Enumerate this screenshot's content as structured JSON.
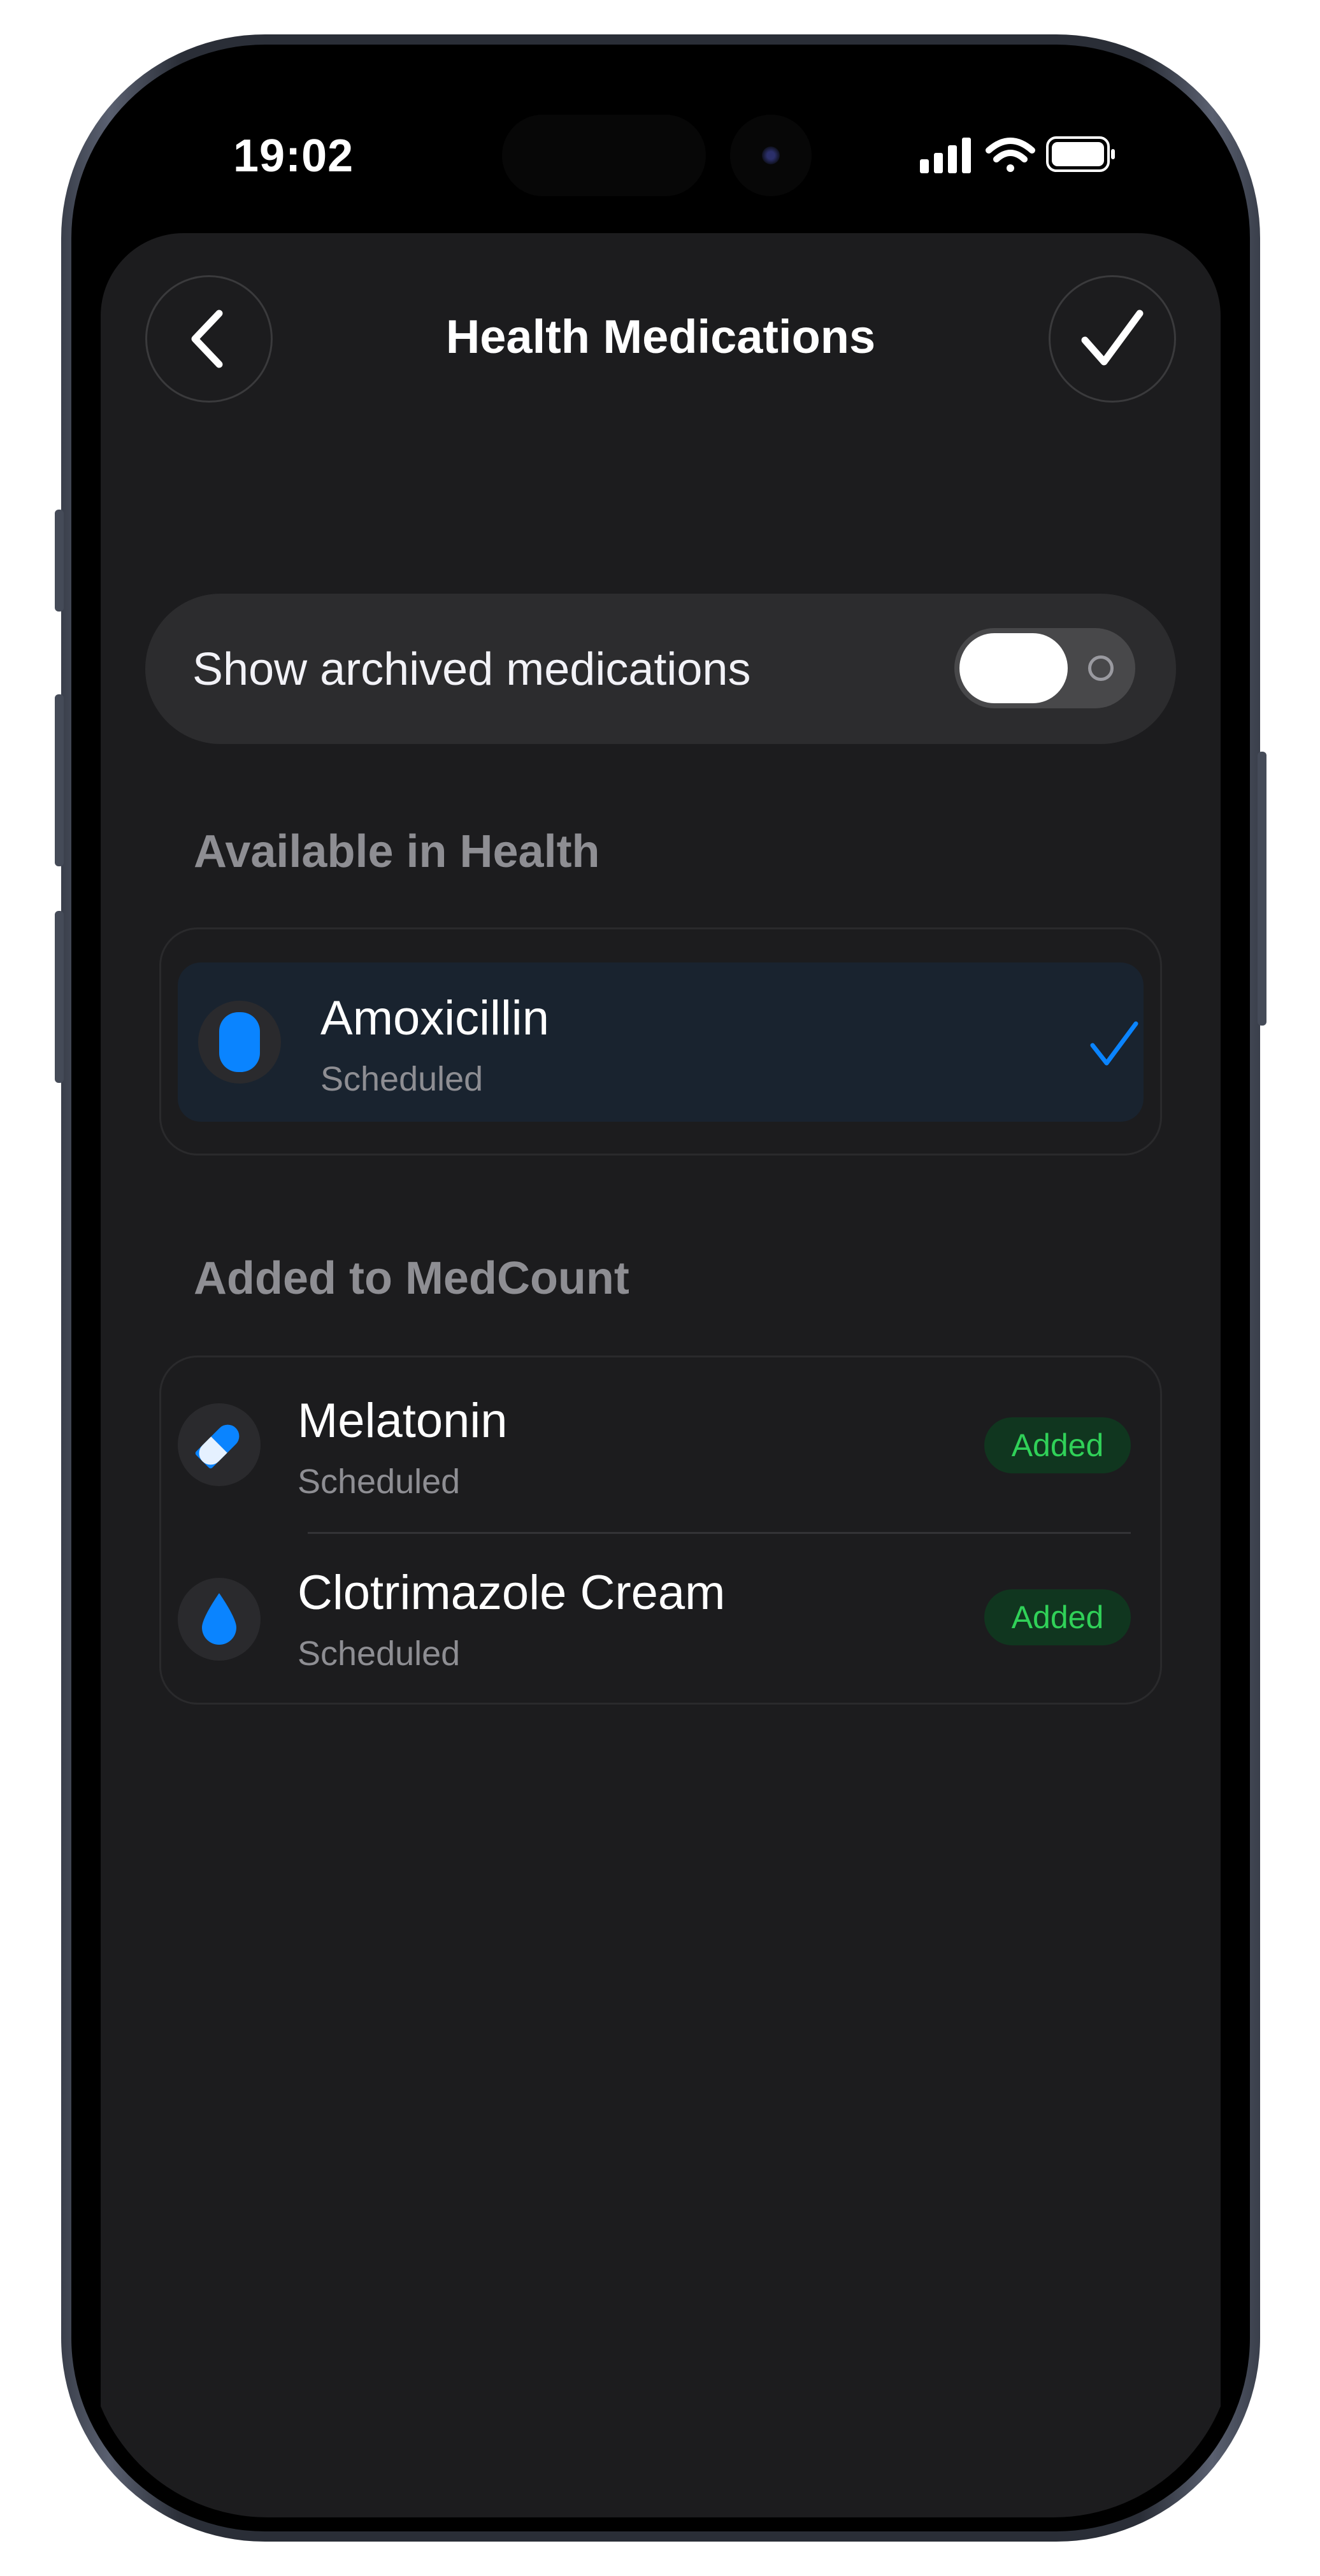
{
  "status_bar": {
    "time": "19:02",
    "icons": [
      "cellular-signal-icon",
      "wifi-icon",
      "battery-icon"
    ]
  },
  "header": {
    "title": "Health Medications",
    "back_icon": "chevron-left-icon",
    "done_icon": "checkmark-icon"
  },
  "toggle": {
    "label": "Show archived medications",
    "on": false
  },
  "sections": {
    "available": {
      "title": "Available in Health",
      "items": [
        {
          "name": "Amoxicillin",
          "status": "Scheduled",
          "icon": "capsule-icon",
          "selected": true
        }
      ]
    },
    "added": {
      "title": "Added to MedCount",
      "items": [
        {
          "name": "Melatonin",
          "status": "Scheduled",
          "icon": "pill-icon",
          "badge": "Added"
        },
        {
          "name": "Clotrimazole Cream",
          "status": "Scheduled",
          "icon": "drop-icon",
          "badge": "Added"
        }
      ]
    }
  },
  "colors": {
    "accent": "#0a84ff",
    "badge_text": "#30d158",
    "background": "#1c1c1e",
    "card": "#2c2c2e"
  }
}
